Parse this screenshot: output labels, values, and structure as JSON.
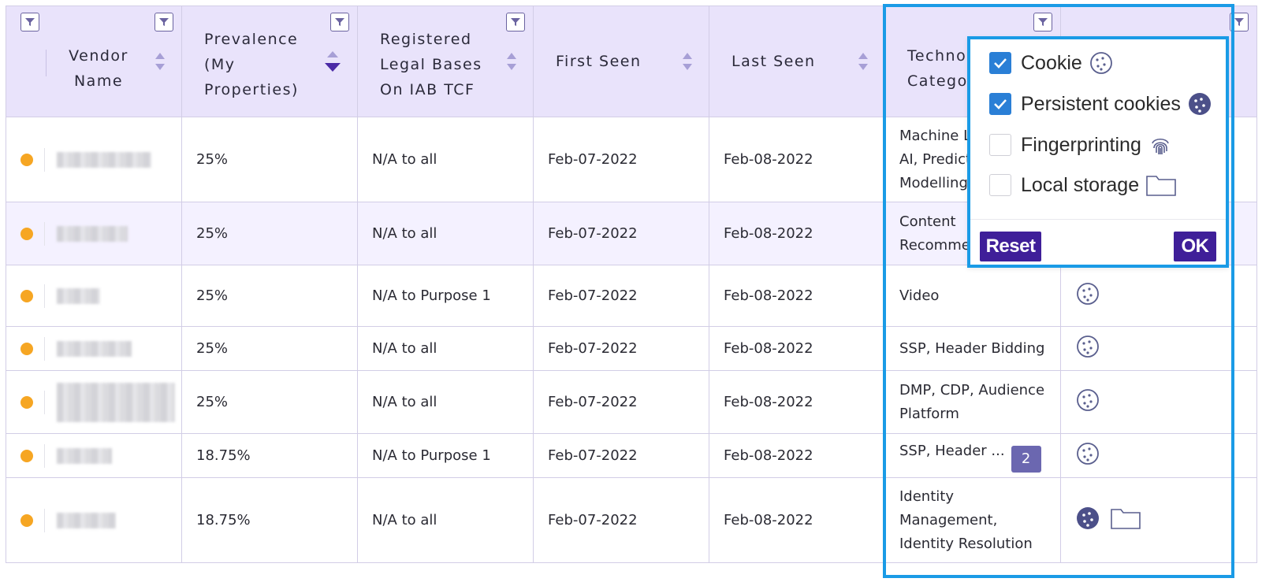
{
  "headers": {
    "vendor_name": "Vendor Name",
    "prevalence": "Prevalence (My Properties)",
    "legal_bases": "Registered Legal Bases On IAB TCF",
    "first_seen": "First Seen",
    "last_seen": "Last Seen",
    "tech_category": "Techno Catego"
  },
  "rows": [
    {
      "prevalence": "25%",
      "legal": "N/A to all",
      "first": "Feb-07-2022",
      "last": "Feb-08-2022",
      "category": "Machine L AI, Predict Modelling",
      "category_lines": [
        "Machine L",
        "AI, Predict",
        "Modelling"
      ],
      "icons": []
    },
    {
      "prevalence": "25%",
      "legal": "N/A to all",
      "first": "Feb-07-2022",
      "last": "Feb-08-2022",
      "category": "Content Recomme",
      "category_lines": [
        "Content",
        "Recomme"
      ],
      "icons": []
    },
    {
      "prevalence": "25%",
      "legal": "N/A to Purpose 1",
      "first": "Feb-07-2022",
      "last": "Feb-08-2022",
      "category": "Video",
      "category_lines": [
        "Video"
      ],
      "icons": [
        "cookie-icon"
      ]
    },
    {
      "prevalence": "25%",
      "legal": "N/A to all",
      "first": "Feb-07-2022",
      "last": "Feb-08-2022",
      "category": "SSP, Header Bidding",
      "category_lines": [
        "SSP, Header Bidding"
      ],
      "icons": [
        "cookie-icon"
      ]
    },
    {
      "prevalence": "25%",
      "legal": "N/A to all",
      "first": "Feb-07-2022",
      "last": "Feb-08-2022",
      "category": "DMP, CDP, Audience Platform",
      "category_lines": [
        "DMP, CDP, Audience",
        "Platform"
      ],
      "icons": [
        "cookie-icon"
      ]
    },
    {
      "prevalence": "18.75%",
      "legal": "N/A to Purpose 1",
      "first": "Feb-07-2022",
      "last": "Feb-08-2022",
      "category": "SSP, Header ...",
      "category_lines": [
        "SSP, Header ..."
      ],
      "badge": "2",
      "icons": [
        "cookie-icon"
      ]
    },
    {
      "prevalence": "18.75%",
      "legal": "N/A to all",
      "first": "Feb-07-2022",
      "last": "Feb-08-2022",
      "category": "Identity Management, Identity Resolution",
      "category_lines": [
        "Identity",
        "Management,",
        "Identity Resolution"
      ],
      "icons": [
        "persistent-cookie-icon",
        "folder-icon"
      ]
    }
  ],
  "filter_dropdown": {
    "options": [
      {
        "label": "Cookie",
        "checked": true,
        "icon": "cookie-icon"
      },
      {
        "label": "Persistent cookies",
        "checked": true,
        "icon": "persistent-cookie-icon"
      },
      {
        "label": "Fingerprinting",
        "checked": false,
        "icon": "fingerprint-icon"
      },
      {
        "label": "Local storage",
        "checked": false,
        "icon": "folder-icon"
      }
    ],
    "reset_label": "Reset",
    "ok_label": "OK"
  },
  "colors": {
    "header_bg": "#e9e3fb",
    "status_dot": "#f6a623",
    "accent_purple": "#3f1f99",
    "highlight_blue": "#1a9be6",
    "checkbox_blue": "#2a7fd6"
  }
}
